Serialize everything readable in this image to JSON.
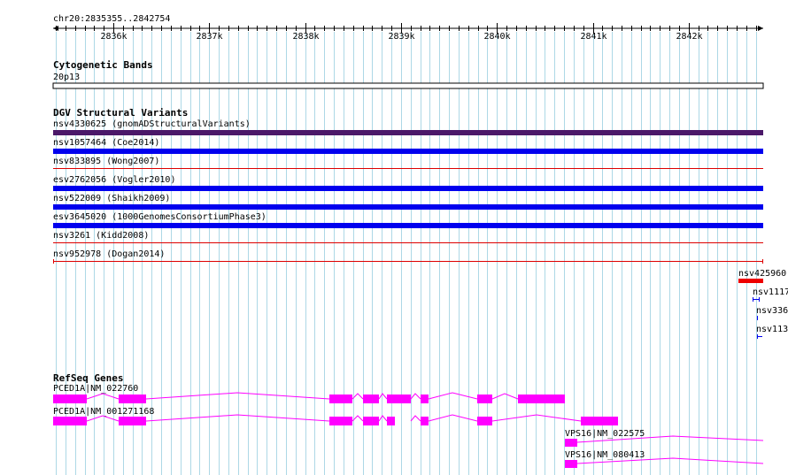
{
  "ruler": {
    "location": "chr20:2835355..2842754",
    "ticks": [
      "2836k",
      "2837k",
      "2838k",
      "2839k",
      "2840k",
      "2841k",
      "2842k"
    ]
  },
  "cytobands": {
    "title": "Cytogenetic Bands",
    "band": "20p13"
  },
  "dgv": {
    "title": "DGV Structural Variants",
    "features": [
      {
        "label": "nsv4330625 (gnomADStructuralVariants)",
        "color": "#4b1869"
      },
      {
        "label": "nsv1057464 (Coe2014)",
        "color": "#0000ee"
      },
      {
        "label": "nsv833895 (Wong2007)",
        "color": "#dd0000"
      },
      {
        "label": "esv2762056 (Vogler2010)",
        "color": "#0000ee"
      },
      {
        "label": "nsv522009 (Shaikh2009)",
        "color": "#0000ee"
      },
      {
        "label": "esv3645020 (1000GenomesConsortiumPhase3)",
        "color": "#0000ee"
      },
      {
        "label": "nsv3261 (Kidd2008)",
        "color": "#dd0000"
      },
      {
        "label": "nsv952978 (Dogan2014)",
        "color": "#dd0000"
      }
    ],
    "overflow": [
      {
        "label": "nsv425960",
        "color": "#ee0000"
      },
      {
        "label": "nsv1117",
        "color": "#0000ee"
      },
      {
        "label": "nsv336",
        "color": "#0000ee"
      },
      {
        "label": "nsv113",
        "color": "#0000ee"
      }
    ]
  },
  "refseq": {
    "title": "RefSeq Genes",
    "color": "#ff00ff",
    "transcripts": [
      {
        "label": "PCED1A|NM_022760"
      },
      {
        "label": "PCED1A|NM_001271168"
      },
      {
        "label": "VPS16|NM_022575"
      },
      {
        "label": "VPS16|NM_080413"
      }
    ]
  },
  "colors": {
    "grid": "#add8e6",
    "ruler": "#000000"
  }
}
